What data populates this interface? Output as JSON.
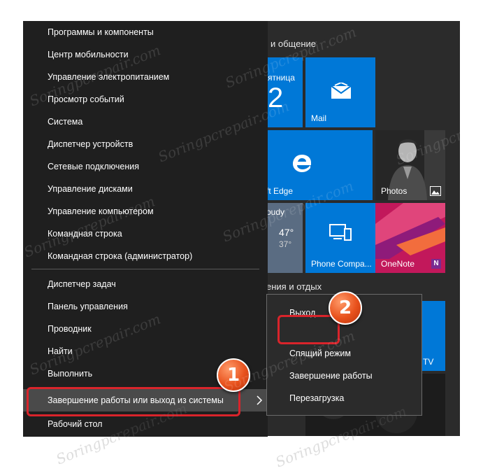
{
  "start_menu": {
    "section_social": "и общение",
    "section_entertainment": "ения и отдых",
    "tiles": {
      "calendar_day": "ятница",
      "calendar_num": "2",
      "mail": "Mail",
      "edge": "ft Edge",
      "photos": "Photos",
      "weather_city": "oudy",
      "weather_temp_hi": "47°",
      "weather_temp_lo": "37°",
      "phone_companion": "Phone Compa...",
      "onenote": "OneNote",
      "tv": "TV"
    }
  },
  "winx_menu": {
    "items": [
      "Программы и компоненты",
      "Центр мобильности",
      "Управление электропитанием",
      "Просмотр событий",
      "Система",
      "Диспетчер устройств",
      "Сетевые подключения",
      "Управление дисками",
      "Управление компьютером",
      "Командная строка",
      "Командная строка (администратор)",
      "Диспетчер задач",
      "Панель управления",
      "Проводник",
      "Найти",
      "Выполнить",
      "Завершение работы или выход из системы",
      "Рабочий стол"
    ]
  },
  "submenu": {
    "items": [
      "Выход",
      "Спящий режим",
      "Завершение работы",
      "Перезагрузка"
    ]
  },
  "badges": [
    "1",
    "2"
  ],
  "watermark": "Soringpcrepair.com",
  "colors": {
    "accent": "#0078d7",
    "highlight_red": "#d9242b",
    "badge_orange": "#e8511c",
    "menu_bg": "#1f1f1f"
  }
}
